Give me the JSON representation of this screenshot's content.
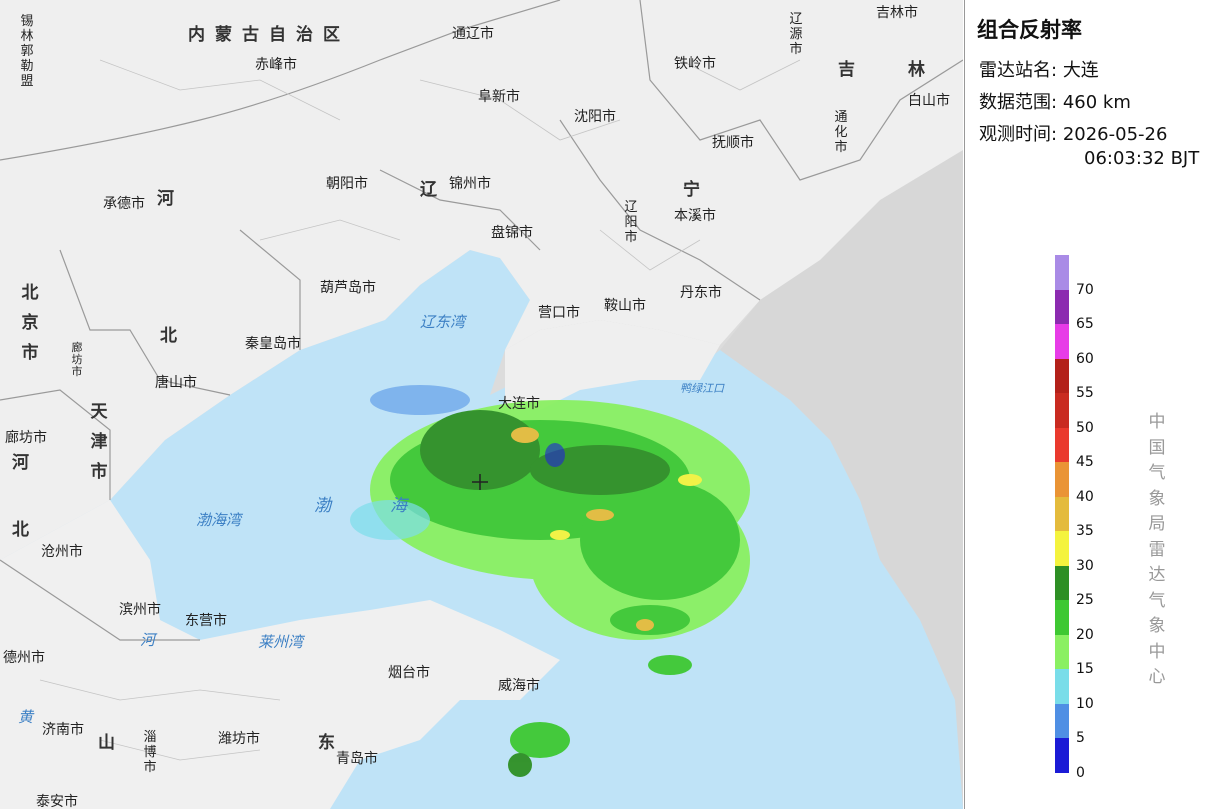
{
  "panel": {
    "title": "组合反射率",
    "station_label": "雷达站名:",
    "station_value": "大连",
    "range_label": "数据范围:",
    "range_value": "460 km",
    "time_label": "观测时间:",
    "date_value": "2026-05-26",
    "time_value": "06:03:32 BJT",
    "credit": "中国气象局雷达气象中心"
  },
  "legend": [
    {
      "value": "",
      "color": "#a98be6"
    },
    {
      "value": "70",
      "color": "#8c2bb0"
    },
    {
      "value": "65",
      "color": "#e73ce7"
    },
    {
      "value": "60",
      "color": "#b3211a"
    },
    {
      "value": "55",
      "color": "#c92b21"
    },
    {
      "value": "50",
      "color": "#ea3a2e"
    },
    {
      "value": "45",
      "color": "#ea9435"
    },
    {
      "value": "40",
      "color": "#e4bb3c"
    },
    {
      "value": "35",
      "color": "#f4f33e"
    },
    {
      "value": "30",
      "color": "#2e8f24"
    },
    {
      "value": "25",
      "color": "#3ec832"
    },
    {
      "value": "20",
      "color": "#8af062"
    },
    {
      "value": "15",
      "color": "#79dde9"
    },
    {
      "value": "10",
      "color": "#4f8fe4"
    },
    {
      "value": "5",
      "color": "#1b1bd6"
    },
    {
      "value": "0",
      "color": ""
    }
  ],
  "map": {
    "provinces": {
      "neimenggu": "内蒙古自治区",
      "he": "河",
      "liao": "辽",
      "ning": "宁",
      "ji_a": "吉",
      "ji_b": "林",
      "bei": "北",
      "beijing": "北京市",
      "tianjin": "天津市",
      "hebei_he": "河",
      "hebei_bei": "北",
      "shan": "山",
      "dong": "东",
      "xilinguole": "锡林郭勒盟",
      "langfang_small": "廊坊市",
      "liaoyuan": "辽源市",
      "tonghua": "通化市",
      "liaoyang": "辽阳市",
      "zibo": "淄博市"
    },
    "cities": {
      "chifeng": "赤峰市",
      "tongliao": "通辽市",
      "tieling": "铁岭市",
      "jilin": "吉林市",
      "baishan": "白山市",
      "fuxin": "阜新市",
      "shenyang": "沈阳市",
      "fushun": "抚顺市",
      "chaoyang": "朝阳市",
      "jinzhou": "锦州市",
      "chengde": "承德市",
      "benxi": "本溪市",
      "panjin": "盘锦市",
      "huludao": "葫芦岛市",
      "dandong": "丹东市",
      "yingkou": "营口市",
      "anshan": "鞍山市",
      "qinhuangdao": "秦皇岛市",
      "tangshan": "唐山市",
      "dalian": "大连市",
      "langfang": "廊坊市",
      "cangzhou": "沧州市",
      "binzhou": "滨州市",
      "dongying": "东营市",
      "dezhou": "德州市",
      "yantai": "烟台市",
      "weihai": "威海市",
      "jinan": "济南市",
      "weifang": "潍坊市",
      "qingdao": "青岛市",
      "taian": "泰安市"
    },
    "seas": {
      "liaodong_bay": "辽东湾",
      "bohai_bay": "渤海湾",
      "bohai_a": "渤",
      "bohai_b": "海",
      "laizhou_bay": "莱州湾",
      "yalu": "鸭绿江口",
      "river_he": "河",
      "river_huang": "黄"
    }
  }
}
